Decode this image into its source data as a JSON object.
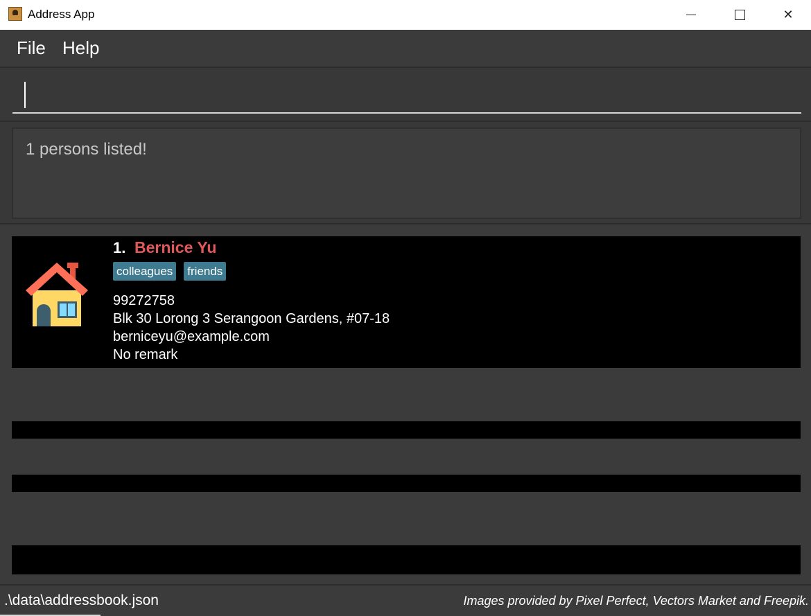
{
  "window": {
    "title": "Address App",
    "controls": {
      "minimize": "",
      "maximize": "",
      "close": "✕"
    }
  },
  "menu": {
    "file_label": "File",
    "help_label": "Help"
  },
  "command": {
    "value": "",
    "placeholder": ""
  },
  "result": {
    "text": "1 persons listed!"
  },
  "persons": [
    {
      "index": "1.",
      "name": "Bernice Yu",
      "tags": [
        "colleagues",
        "friends"
      ],
      "phone": "99272758",
      "address": "Blk 30 Lorong 3 Serangoon Gardens, #07-18",
      "email": "berniceyu@example.com",
      "remark": "No remark",
      "avatar_icon": "house-icon"
    }
  ],
  "status": {
    "file_path": ".\\data\\addressbook.json",
    "credits": "Images provided by Pixel Perfect, Vectors Market and Freepik."
  },
  "colors": {
    "background": "#3b3b3b",
    "card": "#000000",
    "name": "#e0575b",
    "tag": "#3e7b91"
  }
}
